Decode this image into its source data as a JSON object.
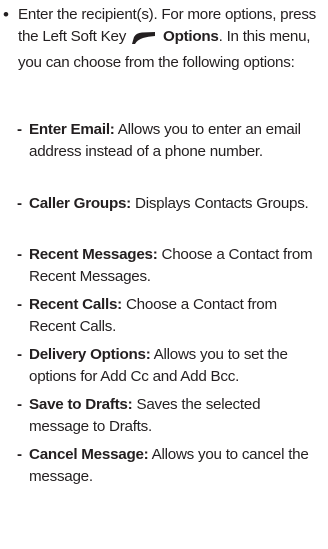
{
  "intro": {
    "bullet": "•",
    "text_before_key": "Enter the recipient(s). For more options, press the Left Soft Key",
    "key_icon": "left-soft-key-icon",
    "key_label": "Options",
    "text_after_key": ". In this menu, you can choose from the following options:"
  },
  "options": [
    {
      "dash": "-",
      "label": "Enter Email:",
      "description": "Allows you to enter an email address instead of a phone number."
    },
    {
      "dash": "-",
      "label": "Caller Groups:",
      "description": "Displays Contacts Groups."
    },
    {
      "dash": "-",
      "label": "Recent Messages:",
      "description": "Choose a Contact from Recent Messages."
    },
    {
      "dash": "-",
      "label": "Recent Calls:",
      "description": "Choose a Contact from Recent Calls."
    },
    {
      "dash": "-",
      "label": "Delivery Options:",
      "description": "Allows you to set the options for Add Cc and Add Bcc."
    },
    {
      "dash": "-",
      "label": "Save to Drafts:",
      "description": "Saves the selected message to Drafts."
    },
    {
      "dash": "-",
      "label": "Cancel Message:",
      "description": "Allows you to cancel the message."
    }
  ]
}
